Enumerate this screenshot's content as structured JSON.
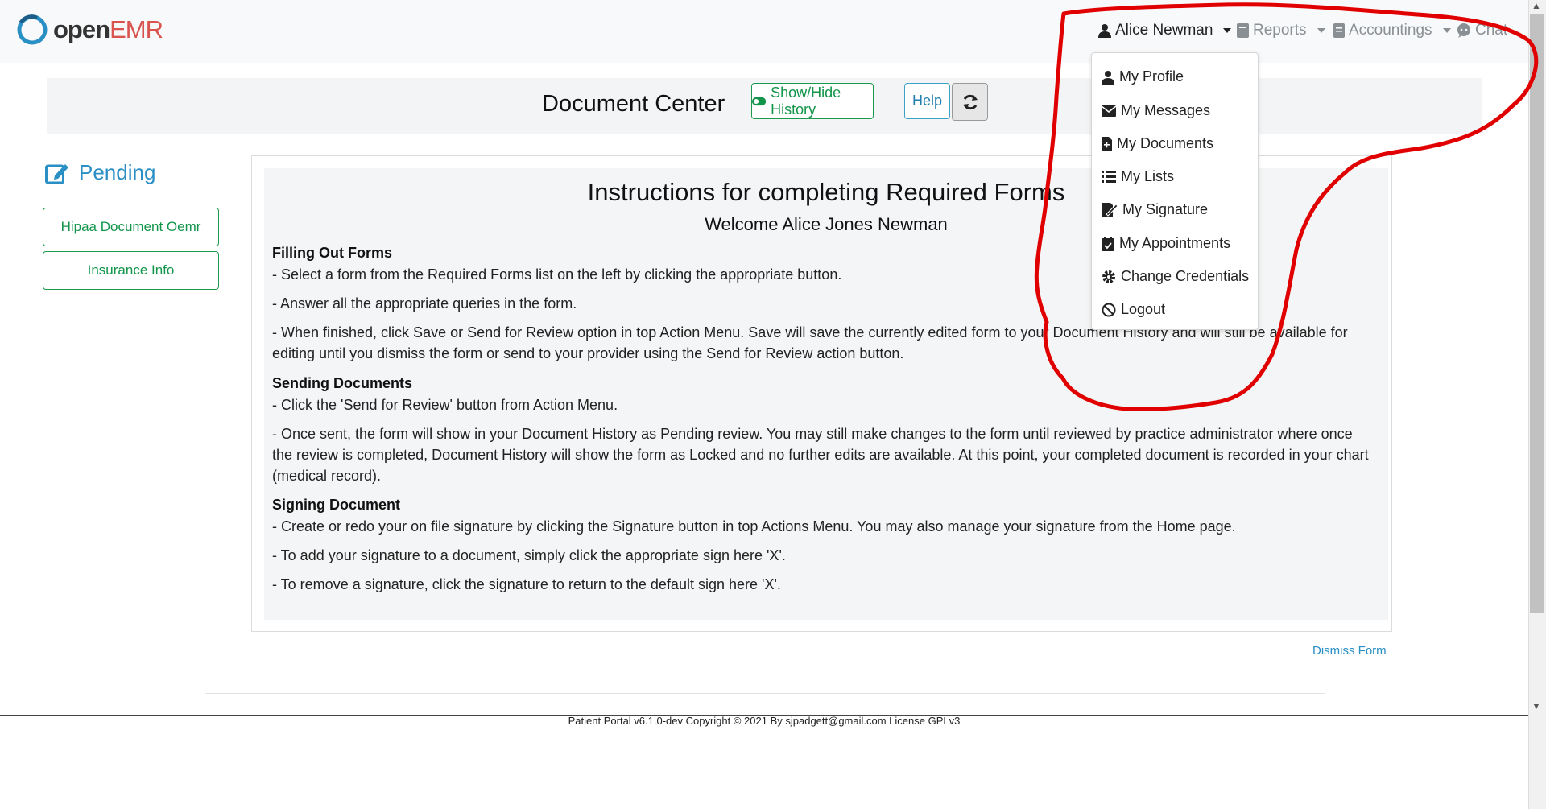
{
  "app": {
    "logo_open": "open",
    "logo_emr": "EMR"
  },
  "nav": {
    "user": "Alice Newman",
    "reports": "Reports",
    "accountings": "Accountings",
    "chat": "Chat"
  },
  "user_menu": [
    {
      "label": "My Profile",
      "icon": "user-icon"
    },
    {
      "label": "My Messages",
      "icon": "envelope-icon"
    },
    {
      "label": "My Documents",
      "icon": "file-icon"
    },
    {
      "label": "My Lists",
      "icon": "list-icon"
    },
    {
      "label": "My Signature",
      "icon": "signature-icon"
    },
    {
      "label": "My Appointments",
      "icon": "calendar-icon"
    },
    {
      "label": "Change Credentials",
      "icon": "gear-icon"
    },
    {
      "label": "Logout",
      "icon": "ban-icon"
    }
  ],
  "header": {
    "title": "Document Center",
    "show_hide_history": "Show/Hide History",
    "help": "Help"
  },
  "sidebar": {
    "pending_title": "Pending",
    "forms": [
      "Hipaa Document Oemr",
      "Insurance Info"
    ]
  },
  "instructions": {
    "title": "Instructions for completing Required Forms",
    "welcome": "Welcome Alice Jones Newman",
    "filling_head": "Filling Out Forms",
    "filling": [
      "- Select a form from the Required Forms list on the left by clicking the appropriate button.",
      "- Answer all the appropriate queries in the form.",
      "- When finished, click Save or Send for Review option in top Action Menu. Save will save the currently edited form to your Document History and will still be available for editing until you dismiss the form or send to your provider using the Send for Review action button."
    ],
    "sending_head": "Sending Documents",
    "sending": [
      "- Click the 'Send for Review' button from Action Menu.",
      "- Once sent, the form will show in your Document History as Pending review. You may still make changes to the form until reviewed by practice administrator where once the review is completed, Document History will show the form as Locked and no further edits are available. At this point, your completed document is recorded in your chart (medical record)."
    ],
    "signing_head": "Signing Document",
    "signing": [
      "- Create or redo your on file signature by clicking the Signature button in top Actions Menu. You may also manage your signature from the Home page.",
      "- To add your signature to a document, simply click the appropriate sign here 'X'.",
      "- To remove a signature, click the signature to return to the default sign here 'X'."
    ]
  },
  "dismiss": "Dismiss Form",
  "footer": "Patient Portal v6.1.0-dev Copyright © 2021 By sjpadgett@gmail.com License GPLv3",
  "colors": {
    "accent_green": "#12954a",
    "link_blue": "#2a8fc4",
    "annotation_red": "#e00000"
  }
}
